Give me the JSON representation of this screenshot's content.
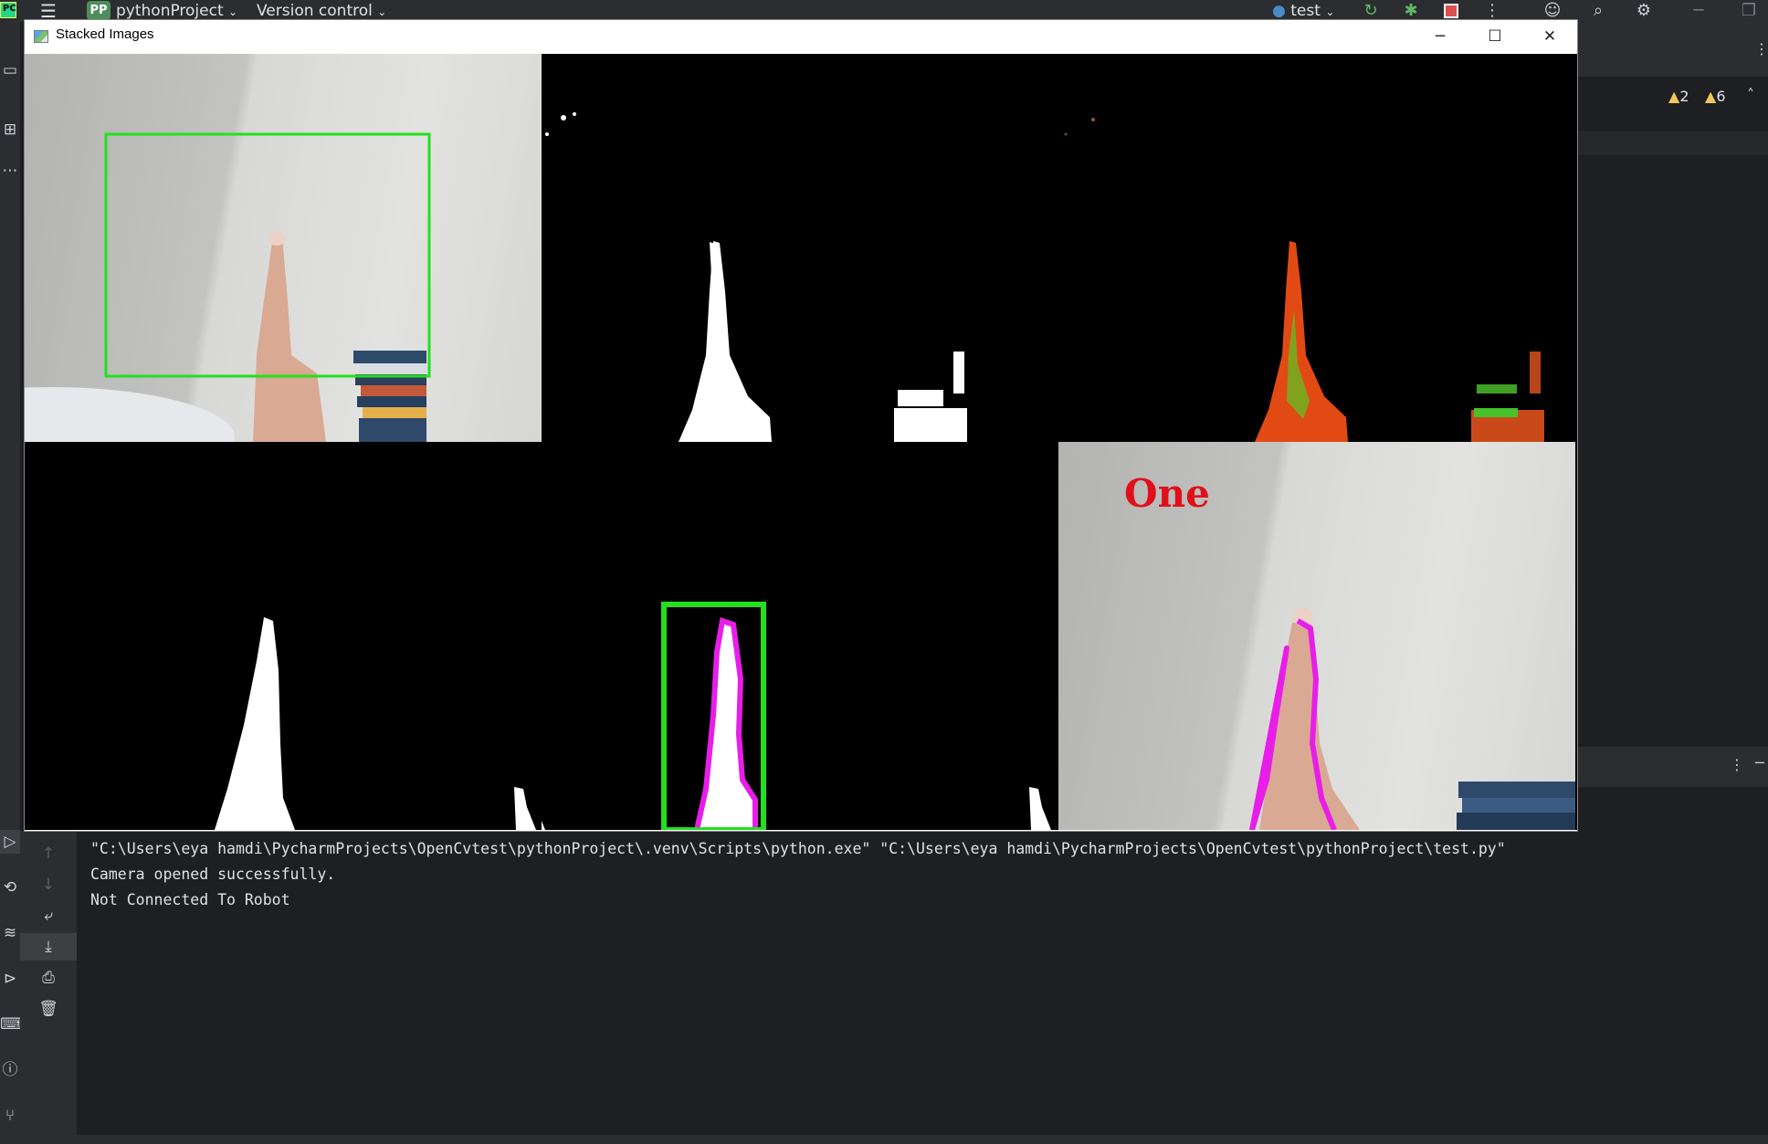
{
  "ide": {
    "project_badge": "PP",
    "project_name": "pythonProject",
    "version_control": "Version control",
    "run_config": "test",
    "warnings_count": "2",
    "weak_warnings_count": "6"
  },
  "window": {
    "title": "Stacked Images",
    "minimize_glyph": "─",
    "maximize_glyph": "☐",
    "close_glyph": "✕",
    "overlay_label": "One"
  },
  "console": {
    "lines": [
      "\"C:\\Users\\eya hamdi\\PycharmProjects\\OpenCvtest\\pythonProject\\.venv\\Scripts\\python.exe\" \"C:\\Users\\eya hamdi\\PycharmProjects\\OpenCvtest\\pythonProject\\test.py\"",
      "Camera opened successfully.",
      "Not Connected To Robot"
    ]
  },
  "icons": {
    "logo": "pycharm-logo",
    "menu": "hamburger-menu-icon",
    "run": "run-icon",
    "debug": "debug-icon",
    "stop": "stop-icon",
    "more": "more-vertical-icon",
    "account": "account-icon",
    "search": "search-icon",
    "settings": "gear-icon"
  },
  "colors": {
    "ide_bg": "#1e1f22",
    "ide_panel": "#2b2d30",
    "bbox_green": "#22e01e",
    "contour_magenta": "#e81ee8",
    "label_red": "#e0101a",
    "stop_red": "#d9504f"
  }
}
